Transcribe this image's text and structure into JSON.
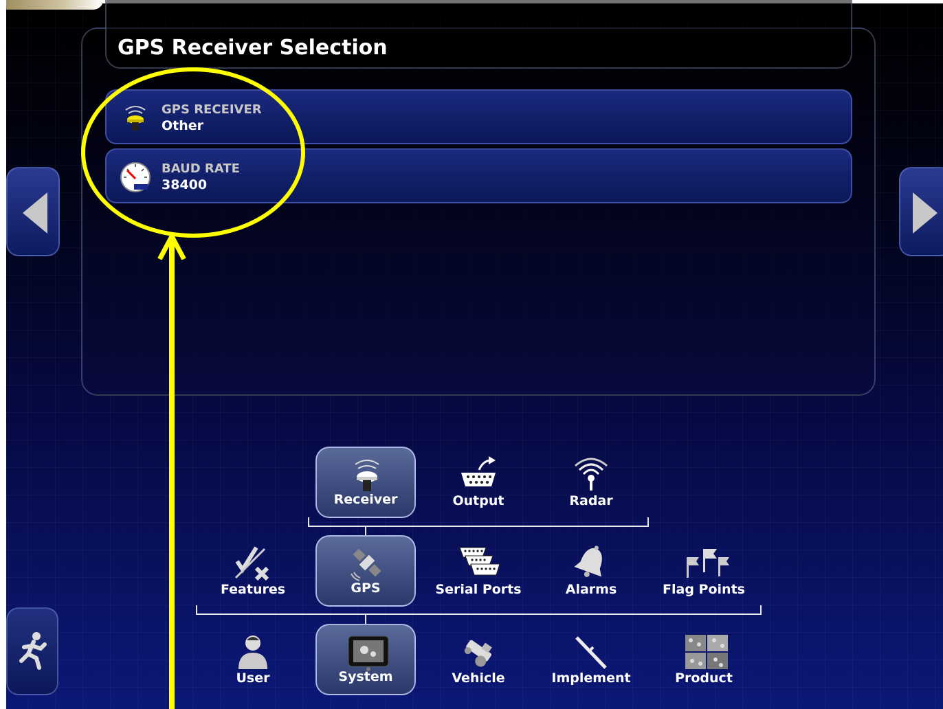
{
  "panel": {
    "title": "GPS Receiver Selection"
  },
  "rows": [
    {
      "label": "GPS RECEIVER",
      "value": "Other",
      "icon": "gps-antenna-icon"
    },
    {
      "label": "BAUD RATE",
      "value": "38400",
      "icon": "gauge-icon"
    }
  ],
  "menu": {
    "level3": [
      {
        "label": "Receiver",
        "icon": "gps-antenna-icon",
        "selected": true
      },
      {
        "label": "Output",
        "icon": "serial-output-icon",
        "selected": false
      },
      {
        "label": "Radar",
        "icon": "radar-icon",
        "selected": false
      }
    ],
    "level2": [
      {
        "label": "Features",
        "icon": "check-cross-icon",
        "selected": false
      },
      {
        "label": "GPS",
        "icon": "satellite-icon",
        "selected": true
      },
      {
        "label": "Serial Ports",
        "icon": "serial-ports-icon",
        "selected": false
      },
      {
        "label": "Alarms",
        "icon": "bell-icon",
        "selected": false
      },
      {
        "label": "Flag Points",
        "icon": "flags-icon",
        "selected": false
      }
    ],
    "level1": [
      {
        "label": "User",
        "icon": "user-icon",
        "selected": false
      },
      {
        "label": "System",
        "icon": "system-icon",
        "selected": true
      },
      {
        "label": "Vehicle",
        "icon": "vehicle-icon",
        "selected": false
      },
      {
        "label": "Implement",
        "icon": "implement-icon",
        "selected": false
      },
      {
        "label": "Product",
        "icon": "product-icon",
        "selected": false
      }
    ]
  },
  "colors": {
    "highlight": "#ffff00",
    "row_bg": "#12206a",
    "accent": "#ffd000"
  }
}
